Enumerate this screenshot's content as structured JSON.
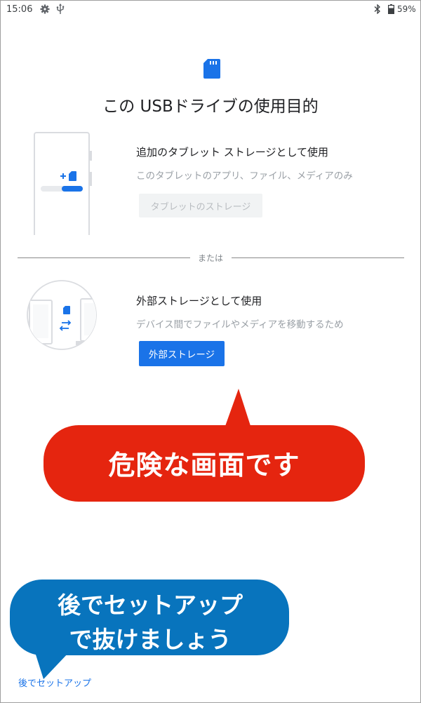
{
  "status_bar": {
    "time": "15:06",
    "icons": [
      "gear-icon",
      "usb-icon",
      "bluetooth-icon",
      "battery-icon"
    ],
    "battery": "59%"
  },
  "page": {
    "title": "この USBドライブの使用目的",
    "icon": "sd-card-icon"
  },
  "option_tablet": {
    "title": "追加のタブレット ストレージとして使用",
    "description": "このタブレットのアプリ、ファイル、メディアのみ",
    "button": "タブレットのストレージ",
    "button_enabled": false
  },
  "divider": {
    "label": "または"
  },
  "option_external": {
    "title": "外部ストレージとして使用",
    "description": "デバイス間でファイルやメディアを移動するため",
    "button": "外部ストレージ",
    "button_enabled": true
  },
  "annotations": {
    "warning": "危険な画面です",
    "hint_line1": "後でセットアップ",
    "hint_line2": "で抜けましょう"
  },
  "footer": {
    "later_link": "後でセットアップ"
  },
  "colors": {
    "accent": "#1a73e8",
    "warning_callout": "#e5250f",
    "hint_callout": "#0874bd",
    "disabled_button": "#f1f3f4"
  }
}
